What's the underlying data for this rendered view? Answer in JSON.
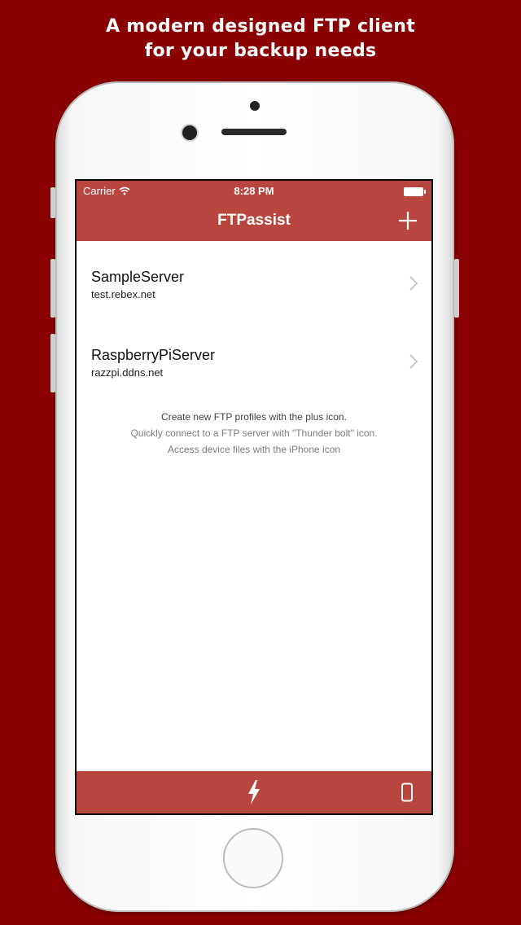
{
  "headline": {
    "line1": "A modern designed FTP client",
    "line2": "for your backup needs"
  },
  "status_bar": {
    "carrier": "Carrier",
    "time": "8:28 PM"
  },
  "nav": {
    "title": "FTPassist",
    "add_icon": "plus-icon"
  },
  "servers": [
    {
      "name": "SampleServer",
      "host": "test.rebex.net"
    },
    {
      "name": "RaspberryPiServer",
      "host": "razzpi.ddns.net"
    }
  ],
  "hints": [
    "Create new FTP profiles with the plus icon.",
    "Quickly connect to a FTP server with \"Thunder bolt\" icon.",
    "Access device files with the iPhone icon"
  ],
  "tab_bar": {
    "quick_connect_icon": "thunder-bolt-icon",
    "device_files_icon": "iphone-icon"
  },
  "colors": {
    "background": "#8a0000",
    "accent": "#b9463e",
    "text": "#111111"
  }
}
